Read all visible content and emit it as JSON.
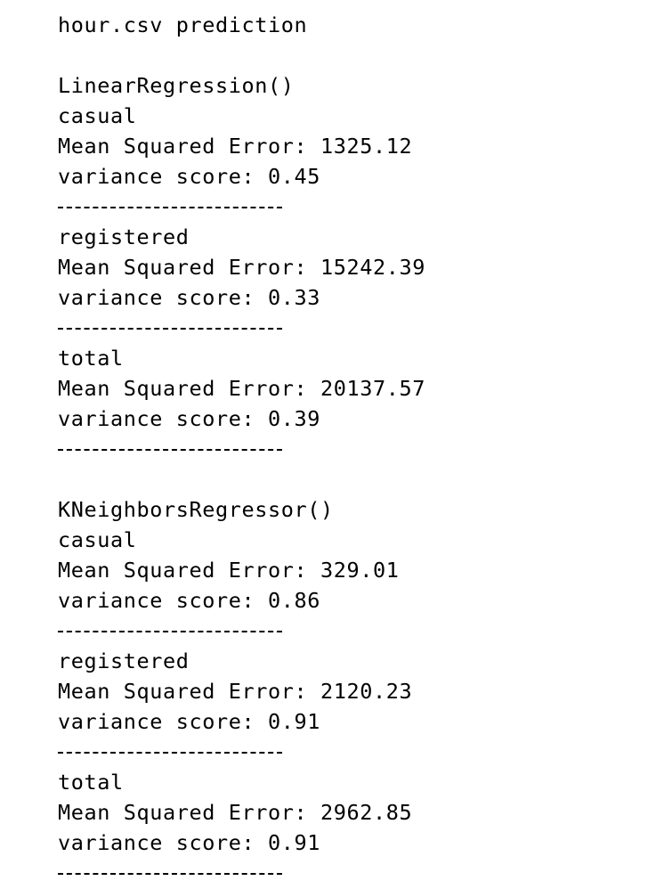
{
  "header": {
    "title": "hour.csv prediction"
  },
  "models": [
    {
      "name": "LinearRegression()",
      "targets": [
        {
          "name": "casual",
          "mse_label": "Mean Squared Error: 1325.12",
          "var_label": "variance score: 0.45"
        },
        {
          "name": "registered",
          "mse_label": "Mean Squared Error: 15242.39",
          "var_label": "variance score: 0.33"
        },
        {
          "name": "total",
          "mse_label": "Mean Squared Error: 20137.57",
          "var_label": "variance score: 0.39"
        }
      ]
    },
    {
      "name": "KNeighborsRegressor()",
      "targets": [
        {
          "name": "casual",
          "mse_label": "Mean Squared Error: 329.01",
          "var_label": "variance score: 0.86"
        },
        {
          "name": "registered",
          "mse_label": "Mean Squared Error: 2120.23",
          "var_label": "variance score: 0.91"
        },
        {
          "name": "total",
          "mse_label": "Mean Squared Error: 2962.85",
          "var_label": "variance score: 0.91"
        }
      ]
    }
  ]
}
